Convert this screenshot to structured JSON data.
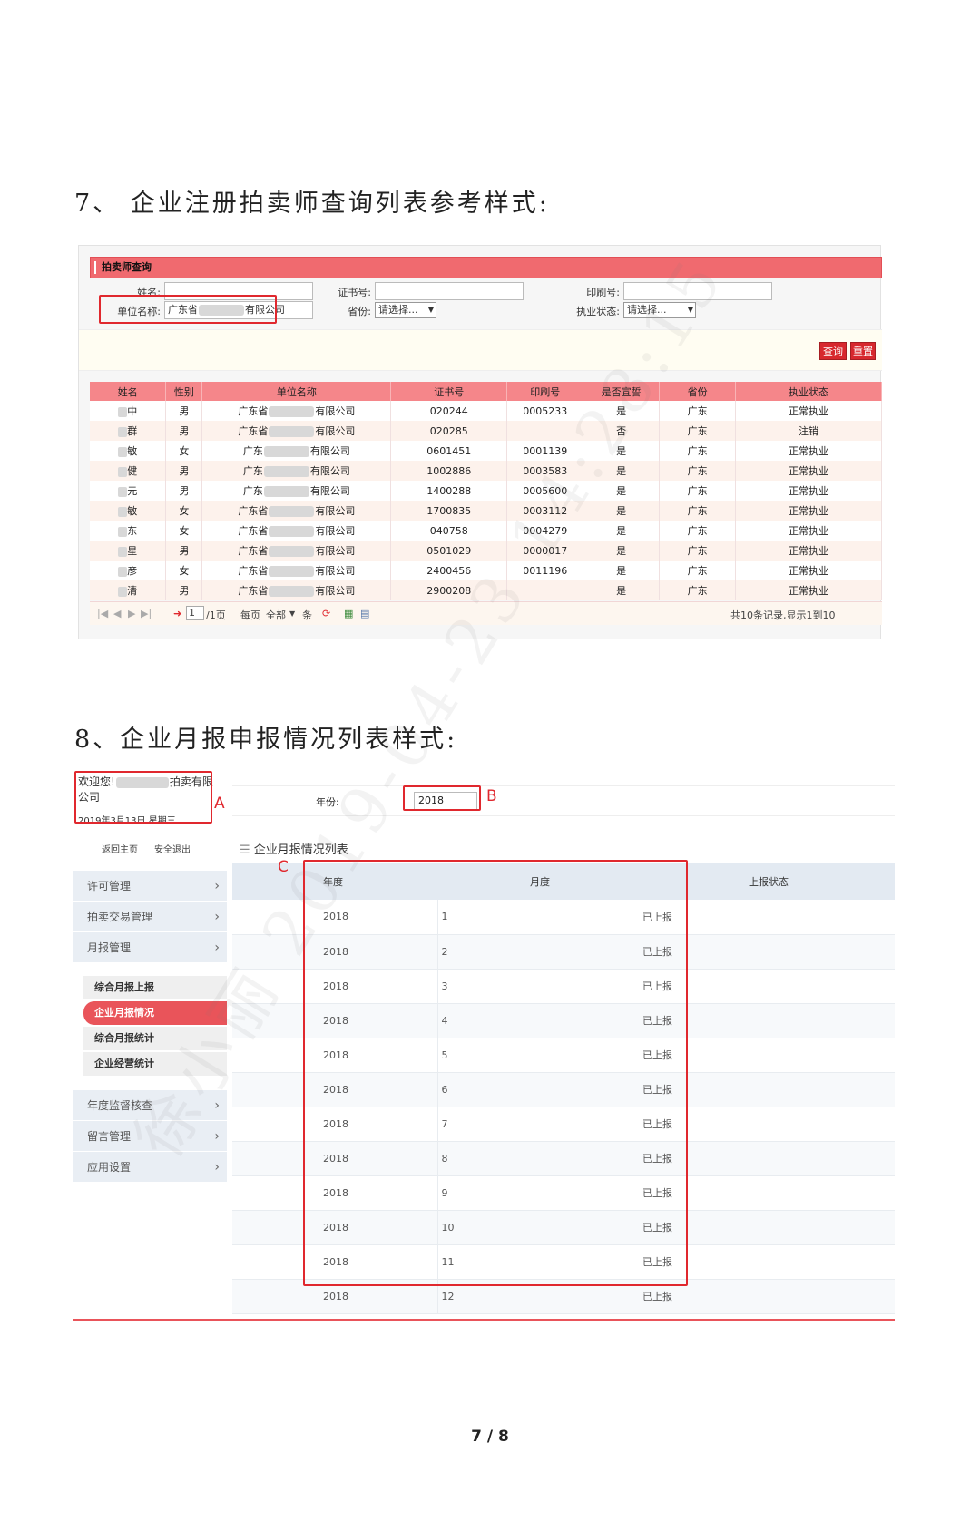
{
  "sec7": {
    "title": "7、    企业注册拍卖师查询列表参考样式:",
    "panel_title": "拍卖师查询",
    "labels": {
      "name": "姓名:",
      "cert": "证书号:",
      "print": "印刷号:",
      "unit": "单位名称:",
      "province": "省份:",
      "status": "执业状态:"
    },
    "unit_value_pre": "广东省",
    "unit_value_post": "有限公司",
    "province_select": "请选择...",
    "status_select": "请选择...",
    "query_button": "查询",
    "reset_button": "重置",
    "columns": [
      "姓名",
      "性别",
      "单位名称",
      "证书号",
      "印刷号",
      "是否宣誓",
      "省份",
      "执业状态"
    ],
    "rows": [
      {
        "name": "中",
        "gender": "男",
        "unit_pre": "广东省",
        "unit_post": "有限公司",
        "cert": "020244",
        "print": "0005233",
        "sworn": "是",
        "province": "广东",
        "status": "正常执业"
      },
      {
        "name": "群",
        "gender": "男",
        "unit_pre": "广东省",
        "unit_post": "有限公司",
        "cert": "020285",
        "print": "",
        "sworn": "否",
        "province": "广东",
        "status": "注销"
      },
      {
        "name": "敏",
        "gender": "女",
        "unit_pre": "广东",
        "unit_post": "有限公司",
        "cert": "0601451",
        "print": "0001139",
        "sworn": "是",
        "province": "广东",
        "status": "正常执业"
      },
      {
        "name": "健",
        "gender": "男",
        "unit_pre": "广东",
        "unit_post": "有限公司",
        "cert": "1002886",
        "print": "0003583",
        "sworn": "是",
        "province": "广东",
        "status": "正常执业"
      },
      {
        "name": "元",
        "gender": "男",
        "unit_pre": "广东",
        "unit_post": "有限公司",
        "cert": "1400288",
        "print": "0005600",
        "sworn": "是",
        "province": "广东",
        "status": "正常执业"
      },
      {
        "name": "敏",
        "gender": "女",
        "unit_pre": "广东省",
        "unit_post": "有限公司",
        "cert": "1700835",
        "print": "0003112",
        "sworn": "是",
        "province": "广东",
        "status": "正常执业"
      },
      {
        "name": "东",
        "gender": "女",
        "unit_pre": "广东省",
        "unit_post": "有限公司",
        "cert": "040758",
        "print": "0004279",
        "sworn": "是",
        "province": "广东",
        "status": "正常执业"
      },
      {
        "name": "星",
        "gender": "男",
        "unit_pre": "广东省",
        "unit_post": "有限公司",
        "cert": "0501029",
        "print": "0000017",
        "sworn": "是",
        "province": "广东",
        "status": "正常执业"
      },
      {
        "name": "彦",
        "gender": "女",
        "unit_pre": "广东省",
        "unit_post": "有限公司",
        "cert": "2400456",
        "print": "0011196",
        "sworn": "是",
        "province": "广东",
        "status": "正常执业"
      },
      {
        "name": "清",
        "gender": "男",
        "unit_pre": "广东省",
        "unit_post": "有限公司",
        "cert": "2900208",
        "print": "",
        "sworn": "是",
        "province": "广东",
        "status": "正常执业"
      }
    ],
    "pager": {
      "page_value": "1",
      "page_total": "/1页",
      "per_page": "每页",
      "per_page_value": "全部",
      "per_page_unit": "条",
      "summary": "共10条记录,显示1到10"
    }
  },
  "sec8": {
    "title": "8、企业月报申报情况列表样式:",
    "welcome_pre": "欢迎您!",
    "welcome_post": "拍卖有限公司",
    "date": "2019年3月13日 星期三",
    "link_home": "返回主页",
    "link_logout": "安全退出",
    "menu": [
      "许可管理",
      "拍卖交易管理",
      "月报管理",
      "年度监督核查",
      "留言管理",
      "应用设置"
    ],
    "submenu": [
      "综合月报上报",
      "企业月报情况",
      "综合月报统计",
      "企业经营统计"
    ],
    "year_label": "年份:",
    "year_value": "2018",
    "list_title": "企业月报情况列表",
    "columns": [
      "年度",
      "月度",
      "上报状态"
    ],
    "rows": [
      {
        "year": "2018",
        "month": "1",
        "status": "已上报"
      },
      {
        "year": "2018",
        "month": "2",
        "status": "已上报"
      },
      {
        "year": "2018",
        "month": "3",
        "status": "已上报"
      },
      {
        "year": "2018",
        "month": "4",
        "status": "已上报"
      },
      {
        "year": "2018",
        "month": "5",
        "status": "已上报"
      },
      {
        "year": "2018",
        "month": "6",
        "status": "已上报"
      },
      {
        "year": "2018",
        "month": "7",
        "status": "已上报"
      },
      {
        "year": "2018",
        "month": "8",
        "status": "已上报"
      },
      {
        "year": "2018",
        "month": "9",
        "status": "已上报"
      },
      {
        "year": "2018",
        "month": "10",
        "status": "已上报"
      },
      {
        "year": "2018",
        "month": "11",
        "status": "已上报"
      },
      {
        "year": "2018",
        "month": "12",
        "status": "已上报"
      }
    ],
    "box_labels": {
      "a": "A",
      "b": "B",
      "c": "C"
    }
  },
  "watermark": "徐小丽 2019-04-23 14:28:15",
  "page_number": "7 / 8",
  "colors": {
    "accent_red": "#e0282e",
    "header_pink": "#f06a6f",
    "menu_active": "#e9545a"
  }
}
